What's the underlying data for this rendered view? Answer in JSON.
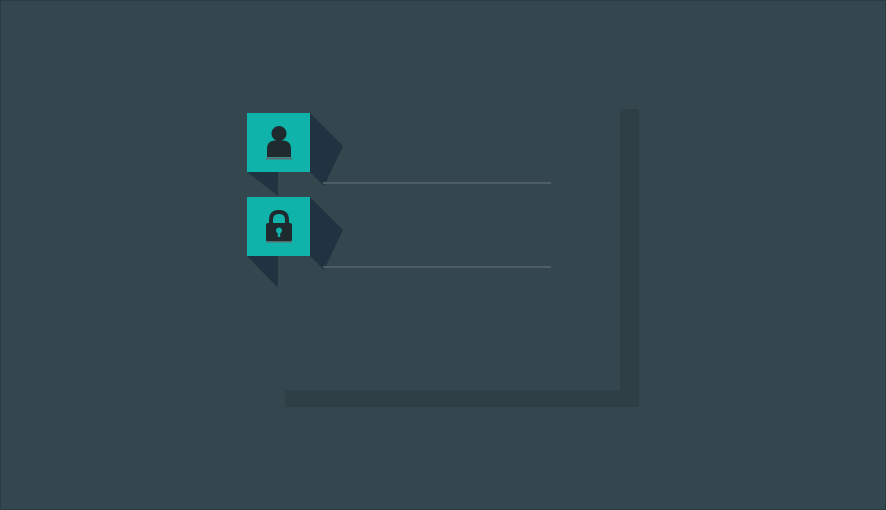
{
  "login_form": {
    "username_field": {
      "icon": "user-icon",
      "value": "",
      "placeholder": ""
    },
    "password_field": {
      "icon": "lock-icon",
      "value": "",
      "placeholder": ""
    }
  },
  "colors": {
    "background": "#34474f",
    "accent": "#0fb3aa",
    "shadow": "#2e3f46",
    "long_shadow": "#1f3340",
    "underline": "#4f5e64",
    "icon_glyph": "#1f2a2e"
  }
}
